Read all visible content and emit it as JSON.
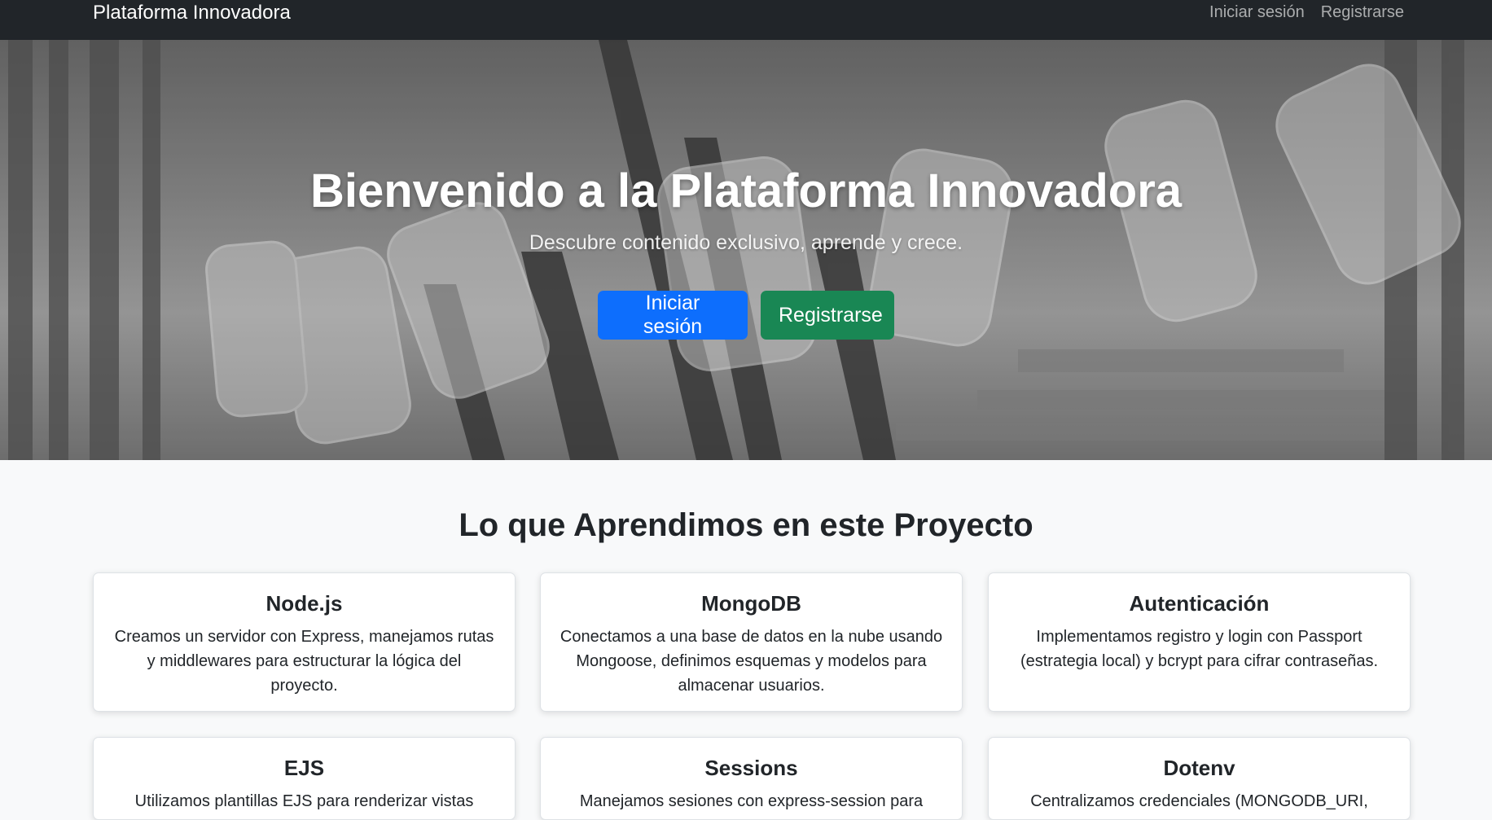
{
  "navbar": {
    "brand": "Plataforma Innovadora",
    "links": [
      "Iniciar sesión",
      "Registrarse"
    ]
  },
  "hero": {
    "title": "Bienvenido a la Plataforma Innovadora",
    "subtitle": "Descubre contenido exclusivo, aprende y crece.",
    "login_button": "Iniciar sesión",
    "register_button": "Registrarse"
  },
  "section": {
    "title": "Lo que Aprendimos en este Proyecto",
    "cards": [
      {
        "title": "Node.js",
        "text": "Creamos un servidor con Express, manejamos rutas y middlewares para estructurar la lógica del proyecto."
      },
      {
        "title": "MongoDB",
        "text": "Conectamos a una base de datos en la nube usando Mongoose, definimos esquemas y modelos para almacenar usuarios."
      },
      {
        "title": "Autenticación",
        "text": "Implementamos registro y login con Passport (estrategia local) y bcrypt para cifrar contraseñas."
      },
      {
        "title": "EJS",
        "text": "Utilizamos plantillas EJS para renderizar vistas"
      },
      {
        "title": "Sessions",
        "text": "Manejamos sesiones con express-session para"
      },
      {
        "title": "Dotenv",
        "text": "Centralizamos credenciales (MONGODB_URI,"
      }
    ]
  },
  "colors": {
    "navbar": "#212529",
    "primary": "#0d6efd",
    "success": "#198754",
    "page_bg": "#f8f9fa"
  }
}
